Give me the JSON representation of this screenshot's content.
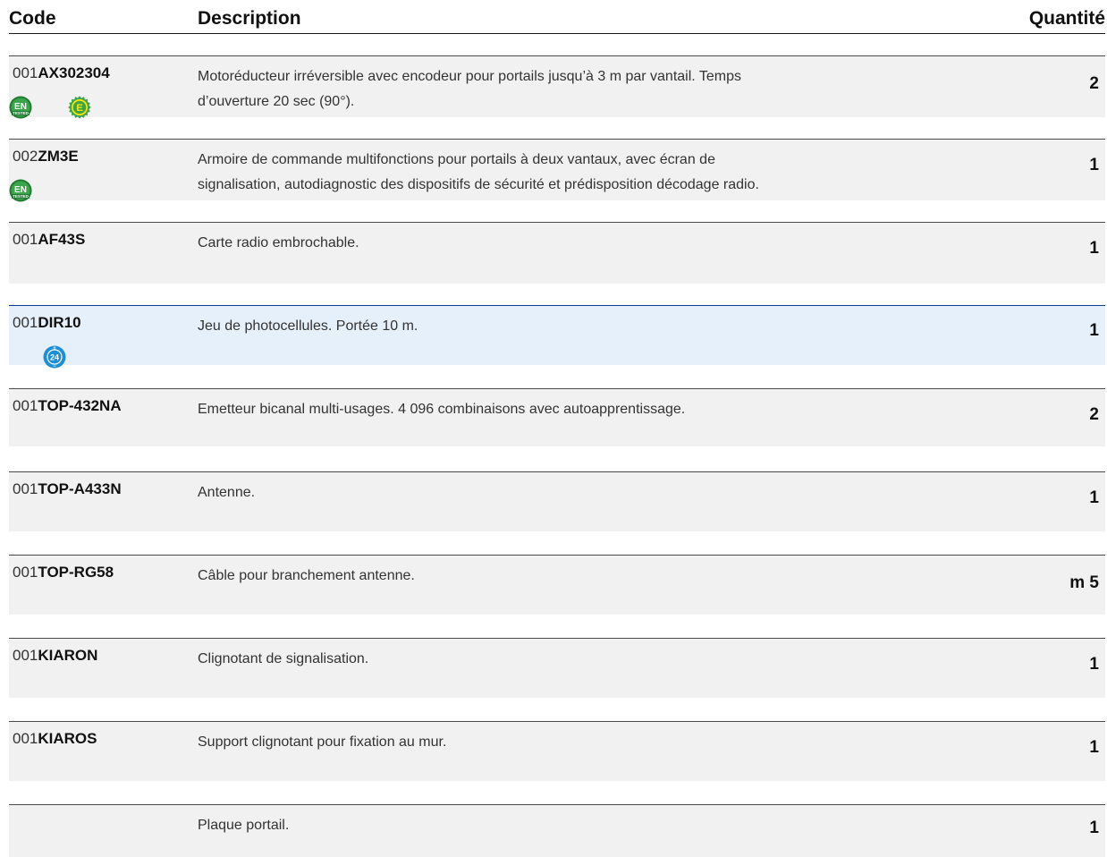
{
  "header": {
    "code": "Code",
    "description": "Description",
    "quantity": "Quantité"
  },
  "rows": [
    {
      "prefix": "001",
      "code": "AX302304",
      "description_lines": [
        "Motoréducteur irréversible avec encodeur pour portails jusqu’à 3 m par vantail. Temps",
        "d’ouverture 20 sec (90°)."
      ],
      "quantity": "2",
      "badges": [
        {
          "icon": "en-tested-badge-icon",
          "text": "EN",
          "sub": "TESTED"
        },
        {
          "icon": "e-energy-badge-icon",
          "text": "E"
        }
      ]
    },
    {
      "prefix": "002",
      "code": "ZM3E",
      "description_lines": [
        "Armoire de commande multifonctions pour portails à deux vantaux, avec écran de",
        "signalisation, autodiagnostic des dispositifs de sécurité et prédisposition décodage radio."
      ],
      "quantity": "1",
      "badges": [
        {
          "icon": "en-tested-badge-icon",
          "text": "EN",
          "sub": "TESTED"
        }
      ]
    },
    {
      "prefix": "001",
      "code": "AF43S",
      "description_lines": [
        "Carte radio embrochable."
      ],
      "quantity": "1",
      "badges": []
    },
    {
      "prefix": "001",
      "code": "DIR10",
      "description_lines": [
        "Jeu de photocellules. Portée 10 m."
      ],
      "quantity": "1",
      "badges": [
        {
          "icon": "24v-badge-icon",
          "text": "24",
          "plus": "+",
          "minus": "−"
        }
      ]
    },
    {
      "prefix": "001",
      "code": "TOP-432NA",
      "description_lines": [
        "Emetteur bicanal multi-usages. 4 096 combinaisons avec autoapprentissage."
      ],
      "quantity": "2",
      "badges": []
    },
    {
      "prefix": "001",
      "code": "TOP-A433N",
      "description_lines": [
        "Antenne."
      ],
      "quantity": "1",
      "badges": []
    },
    {
      "prefix": "001",
      "code": "TOP-RG58",
      "description_lines": [
        "Câble pour branchement antenne."
      ],
      "quantity": "m 5",
      "badges": []
    },
    {
      "prefix": "001",
      "code": "KIARON",
      "description_lines": [
        "Clignotant de signalisation."
      ],
      "quantity": "1",
      "badges": []
    },
    {
      "prefix": "001",
      "code": "KIAROS",
      "description_lines": [
        "Support clignotant pour fixation au mur."
      ],
      "quantity": "1",
      "badges": []
    },
    {
      "prefix": "",
      "code": "",
      "description_lines": [
        "Plaque portail."
      ],
      "quantity": "1",
      "badges": []
    }
  ]
}
